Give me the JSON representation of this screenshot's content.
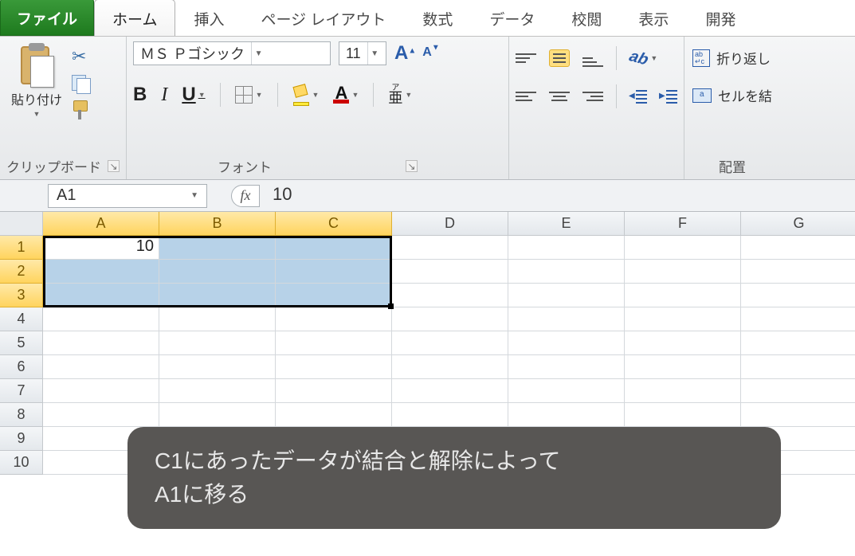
{
  "tabs": {
    "file": "ファイル",
    "home": "ホーム",
    "insert": "挿入",
    "page_layout": "ページ レイアウト",
    "formulas": "数式",
    "data": "データ",
    "review": "校閲",
    "view": "表示",
    "developer": "開発"
  },
  "ribbon": {
    "clipboard": {
      "paste": "貼り付け",
      "label": "クリップボード"
    },
    "font": {
      "name": "ＭＳ Ｐゴシック",
      "size": "11",
      "label": "フォント",
      "bold": "B",
      "italic": "I",
      "underline": "U",
      "fontcolor_letter": "A",
      "phonetic_top": "ア",
      "phonetic_main": "亜"
    },
    "align": {
      "label": "配置",
      "orient_letter": "ab"
    },
    "wrap": {
      "wrap_label": "折り返し",
      "merge_label": "セルを結"
    }
  },
  "formula_bar": {
    "name_box": "A1",
    "fx": "fx",
    "value": "10"
  },
  "columns": [
    "A",
    "B",
    "C",
    "D",
    "E",
    "F",
    "G"
  ],
  "rows": [
    "1",
    "2",
    "3",
    "4",
    "5",
    "6",
    "7",
    "8",
    "9",
    "10"
  ],
  "cells": {
    "A1": "10"
  },
  "selection": {
    "active": "A1",
    "range": "A1:C3"
  },
  "annotation": {
    "line1": "C1にあったデータが結合と解除によって",
    "line2": "A1に移る"
  }
}
